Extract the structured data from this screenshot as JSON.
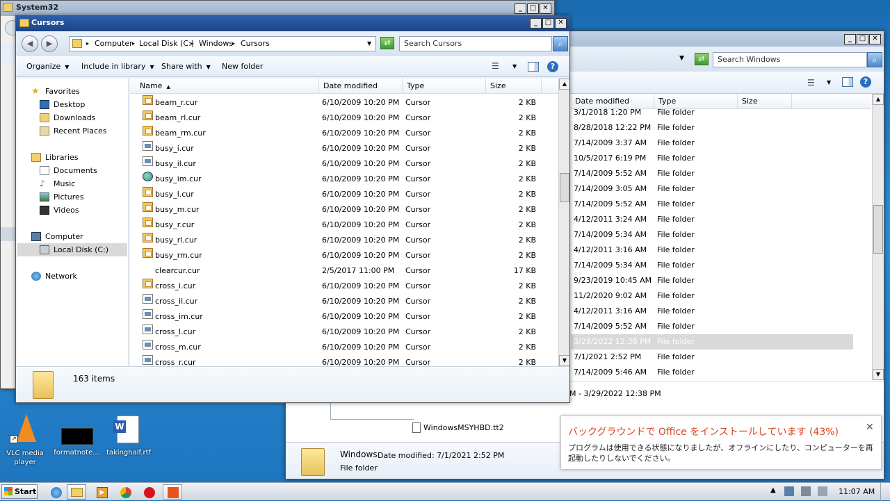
{
  "system32_window": {
    "title": "System32"
  },
  "windows_window": {
    "search_placeholder": "Search Windows",
    "columns": [
      "Date modified",
      "Type",
      "Size"
    ],
    "rows": [
      {
        "date": "3/1/2018 1:20 PM",
        "type": "File folder"
      },
      {
        "date": "8/28/2018 12:22 PM",
        "type": "File folder"
      },
      {
        "date": "7/14/2009 3:37 AM",
        "type": "File folder"
      },
      {
        "date": "10/5/2017 6:19 PM",
        "type": "File folder"
      },
      {
        "date": "7/14/2009 5:52 AM",
        "type": "File folder"
      },
      {
        "date": "7/14/2009 3:05 AM",
        "type": "File folder"
      },
      {
        "date": "7/14/2009 5:52 AM",
        "type": "File folder"
      },
      {
        "date": "4/12/2011 3:24 AM",
        "type": "File folder"
      },
      {
        "date": "7/14/2009 5:34 AM",
        "type": "File folder"
      },
      {
        "date": "4/12/2011 3:16 AM",
        "type": "File folder"
      },
      {
        "date": "7/14/2009 5:34 AM",
        "type": "File folder"
      },
      {
        "date": "9/23/2019 10:45 AM",
        "type": "File folder"
      },
      {
        "date": "11/2/2020 9:02 AM",
        "type": "File folder"
      },
      {
        "date": "4/12/2011 3:16 AM",
        "type": "File folder"
      },
      {
        "date": "7/14/2009 5:52 AM",
        "type": "File folder"
      },
      {
        "date": "3/29/2022 12:38 PM",
        "type": "File folder"
      },
      {
        "date": "7/1/2021 2:52 PM",
        "type": "File folder"
      },
      {
        "date": "7/14/2009 5:46 AM",
        "type": "File folder"
      }
    ],
    "details_partial": "M - 3/29/2022 12:38 PM",
    "details_file": "WindowsMSYHBD.tt2",
    "details_name": "Windows",
    "details_date_label": "Date modified: 7/1/2021 2:52 PM",
    "details_type": "File folder"
  },
  "cursors_window": {
    "title": "Cursors",
    "breadcrumb": [
      "Computer",
      "Local Disk (C:)",
      "Windows",
      "Cursors"
    ],
    "search_placeholder": "Search Cursors",
    "toolbar": {
      "organize": "Organize",
      "include_in_library": "Include in library",
      "share_with": "Share with",
      "new_folder": "New folder"
    },
    "nav": {
      "favorites": "Favorites",
      "desktop": "Desktop",
      "downloads": "Downloads",
      "recent_places": "Recent Places",
      "libraries": "Libraries",
      "documents": "Documents",
      "music": "Music",
      "pictures": "Pictures",
      "videos": "Videos",
      "computer": "Computer",
      "local_disk": "Local Disk (C:)",
      "network": "Network"
    },
    "columns": {
      "name": "Name",
      "date": "Date modified",
      "type": "Type",
      "size": "Size"
    },
    "files": [
      {
        "name": "beam_r.cur",
        "date": "6/10/2009 10:20 PM",
        "type": "Cursor",
        "size": "2 KB",
        "icon": "orange"
      },
      {
        "name": "beam_rl.cur",
        "date": "6/10/2009 10:20 PM",
        "type": "Cursor",
        "size": "2 KB",
        "icon": "orange"
      },
      {
        "name": "beam_rm.cur",
        "date": "6/10/2009 10:20 PM",
        "type": "Cursor",
        "size": "2 KB",
        "icon": "orange"
      },
      {
        "name": "busy_i.cur",
        "date": "6/10/2009 10:20 PM",
        "type": "Cursor",
        "size": "2 KB",
        "icon": "gray"
      },
      {
        "name": "busy_il.cur",
        "date": "6/10/2009 10:20 PM",
        "type": "Cursor",
        "size": "2 KB",
        "icon": "gray"
      },
      {
        "name": "busy_im.cur",
        "date": "6/10/2009 10:20 PM",
        "type": "Cursor",
        "size": "2 KB",
        "icon": "globe"
      },
      {
        "name": "busy_l.cur",
        "date": "6/10/2009 10:20 PM",
        "type": "Cursor",
        "size": "2 KB",
        "icon": "orange"
      },
      {
        "name": "busy_m.cur",
        "date": "6/10/2009 10:20 PM",
        "type": "Cursor",
        "size": "2 KB",
        "icon": "orange"
      },
      {
        "name": "busy_r.cur",
        "date": "6/10/2009 10:20 PM",
        "type": "Cursor",
        "size": "2 KB",
        "icon": "orange"
      },
      {
        "name": "busy_rl.cur",
        "date": "6/10/2009 10:20 PM",
        "type": "Cursor",
        "size": "2 KB",
        "icon": "orange"
      },
      {
        "name": "busy_rm.cur",
        "date": "6/10/2009 10:20 PM",
        "type": "Cursor",
        "size": "2 KB",
        "icon": "orange"
      },
      {
        "name": "clearcur.cur",
        "date": "2/5/2017 11:00 PM",
        "type": "Cursor",
        "size": "17 KB",
        "icon": "blank"
      },
      {
        "name": "cross_i.cur",
        "date": "6/10/2009 10:20 PM",
        "type": "Cursor",
        "size": "2 KB",
        "icon": "orange"
      },
      {
        "name": "cross_il.cur",
        "date": "6/10/2009 10:20 PM",
        "type": "Cursor",
        "size": "2 KB",
        "icon": "gray"
      },
      {
        "name": "cross_im.cur",
        "date": "6/10/2009 10:20 PM",
        "type": "Cursor",
        "size": "2 KB",
        "icon": "gray"
      },
      {
        "name": "cross_l.cur",
        "date": "6/10/2009 10:20 PM",
        "type": "Cursor",
        "size": "2 KB",
        "icon": "gray"
      },
      {
        "name": "cross_m.cur",
        "date": "6/10/2009 10:20 PM",
        "type": "Cursor",
        "size": "2 KB",
        "icon": "gray"
      },
      {
        "name": "cross_r.cur",
        "date": "6/10/2009 10:20 PM",
        "type": "Cursor",
        "size": "2 KB",
        "icon": "gray"
      }
    ],
    "item_count": "163 items"
  },
  "desktop": {
    "icons": [
      {
        "label": "VLC media player"
      },
      {
        "label": "formatnote..."
      },
      {
        "label": "takinghalf.rtf"
      }
    ]
  },
  "notification": {
    "title": "バックグラウンドで Office をインストールしています (43%)",
    "progress_percent": 43,
    "body": "プログラムは使用できる状態になりましたが、オフラインにしたり、コンピューターを再起動したりしないでください。"
  },
  "taskbar": {
    "start_label": "Start",
    "clock": "11:07 AM"
  }
}
